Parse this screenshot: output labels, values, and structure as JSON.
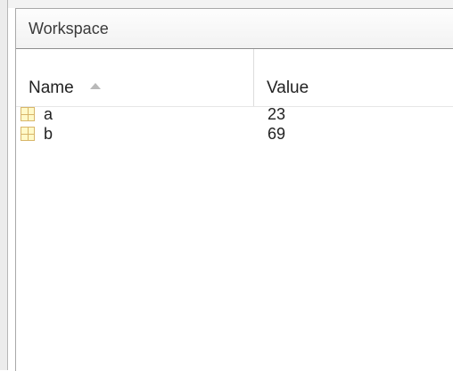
{
  "panel": {
    "title": "Workspace"
  },
  "columns": {
    "name": "Name",
    "value": "Value",
    "sort_icon": "sort-ascending-icon"
  },
  "variables": [
    {
      "name": "a",
      "value": "23",
      "icon": "variable-matrix-icon"
    },
    {
      "name": "b",
      "value": "69",
      "icon": "variable-matrix-icon"
    }
  ],
  "colors": {
    "panel_border": "#a9a9a9",
    "icon_fill": "#fff9c8",
    "icon_border": "#d8b66a"
  }
}
